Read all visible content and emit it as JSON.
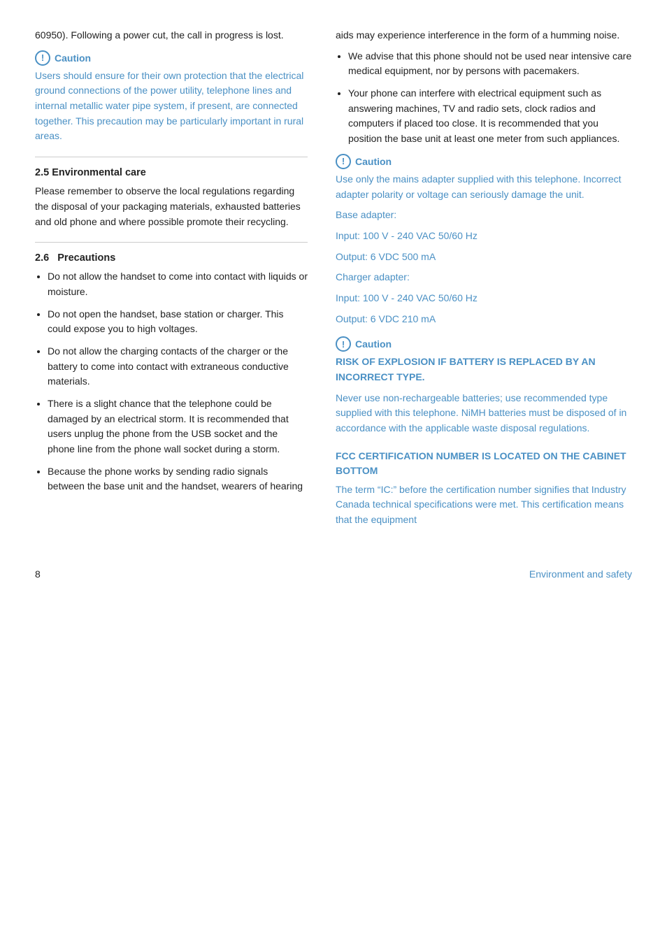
{
  "left": {
    "intro_text": "60950). Following a power cut, the call in progress is lost.",
    "caution1": {
      "label": "Caution",
      "text": "Users should ensure for their own protection that the electrical ground connections of the power utility, telephone lines and internal metallic water pipe system, if present, are connected together. This precaution may be particularly important in rural areas."
    },
    "section25": {
      "number": "2.5",
      "title": "Environmental care",
      "body": "Please remember to observe the local regulations regarding the disposal of your packaging materials, exhausted batteries and old phone and where possible promote their recycling."
    },
    "section26": {
      "number": "2.6",
      "title": "Precautions",
      "items": [
        "Do not allow the handset to come into contact with liquids or moisture.",
        "Do not open the handset, base station or charger. This could expose you to high voltages.",
        "Do not allow the charging contacts of the charger or the battery to come into contact with extraneous conductive materials.",
        "There is a slight chance that the telephone could be damaged by an electrical storm. It is recommended that users unplug the phone from the USB socket and the phone line from the phone wall socket during a storm.",
        "Because the phone works by sending radio signals between the base unit and the handset, wearers of hearing"
      ]
    }
  },
  "right": {
    "intro_text": "aids may experience interference in the form of a humming noise.",
    "bullet_items": [
      "We advise that this phone should not be used near intensive care medical equipment, nor by persons with pacemakers.",
      "Your phone can interfere with electrical equipment such as answering machines, TV and radio sets, clock radios and computers if placed too close. It is recommended that you position the base unit at least one meter from such appliances."
    ],
    "caution2": {
      "label": "Caution",
      "text": "Use only the mains adapter supplied with this telephone. Incorrect adapter polarity or voltage can seriously damage the unit.",
      "details": [
        "Base adapter:",
        "Input: 100 V - 240 VAC 50/60 Hz",
        "Output: 6 VDC 500 mA",
        "Charger adapter:",
        "Input: 100 V - 240 VAC 50/60 Hz",
        "Output: 6 VDC 210 mA"
      ]
    },
    "caution3": {
      "label": "Caution",
      "bold_text": "RISK OF EXPLOSION IF BATTERY IS REPLACED BY AN INCORRECT TYPE.",
      "text": "Never use non-rechargeable batteries; use recommended type supplied with this telephone. NiMH batteries must be disposed of in accordance with the applicable waste disposal regulations."
    },
    "fcc": {
      "heading": "FCC CERTIFICATION NUMBER IS LOCATED ON THE CABINET BOTTOM",
      "text": "The term “IC:” before the certification number signifies that Industry Canada technical specifications were met. This certification means that the equipment"
    }
  },
  "footer": {
    "page_number": "8",
    "section_label": "Environment and safety"
  }
}
